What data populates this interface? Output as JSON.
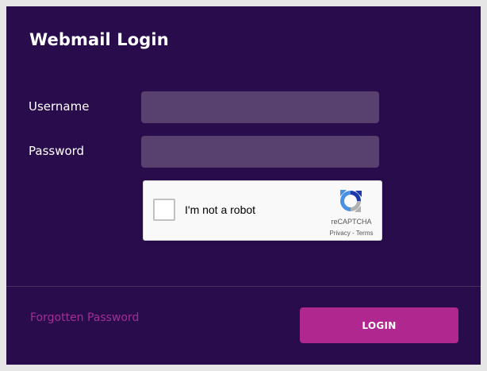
{
  "form": {
    "title": "Webmail Login",
    "username_label": "Username",
    "username_value": "",
    "password_label": "Password",
    "password_value": "",
    "forgot_label": "Forgotten Password",
    "login_label": "LOGIN"
  },
  "recaptcha": {
    "checkbox_label": "I'm not a robot",
    "brand": "reCAPTCHA",
    "privacy_label": "Privacy",
    "separator": " - ",
    "terms_label": "Terms",
    "checked": false,
    "logo_icon": "recaptcha-logo-icon"
  },
  "colors": {
    "background": "#290c4b",
    "input_background": "#58416f",
    "accent": "#b0278f",
    "link": "#a32e97"
  }
}
